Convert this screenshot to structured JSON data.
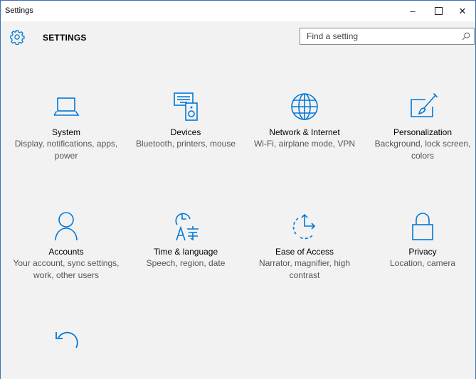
{
  "window": {
    "title": "Settings",
    "minimize": "–",
    "close": "✕"
  },
  "header": {
    "title": "SETTINGS",
    "search_placeholder": "Find a setting"
  },
  "accent_color": "#0078d7",
  "categories": [
    {
      "title": "System",
      "description": "Display, notifications, apps, power",
      "icon": "laptop-icon"
    },
    {
      "title": "Devices",
      "description": "Bluetooth, printers, mouse",
      "icon": "devices-icon"
    },
    {
      "title": "Network & Internet",
      "description": "Wi-Fi, airplane mode, VPN",
      "icon": "globe-icon"
    },
    {
      "title": "Personalization",
      "description": "Background, lock screen, colors",
      "icon": "paintbrush-icon"
    },
    {
      "title": "Accounts",
      "description": "Your account, sync settings, work, other users",
      "icon": "person-icon"
    },
    {
      "title": "Time & language",
      "description": "Speech, region, date",
      "icon": "time-language-icon"
    },
    {
      "title": "Ease of Access",
      "description": "Narrator, magnifier, high contrast",
      "icon": "ease-of-access-icon"
    },
    {
      "title": "Privacy",
      "description": "Location, camera",
      "icon": "lock-icon"
    },
    {
      "title": "",
      "description": "",
      "icon": "update-recovery-icon"
    }
  ]
}
